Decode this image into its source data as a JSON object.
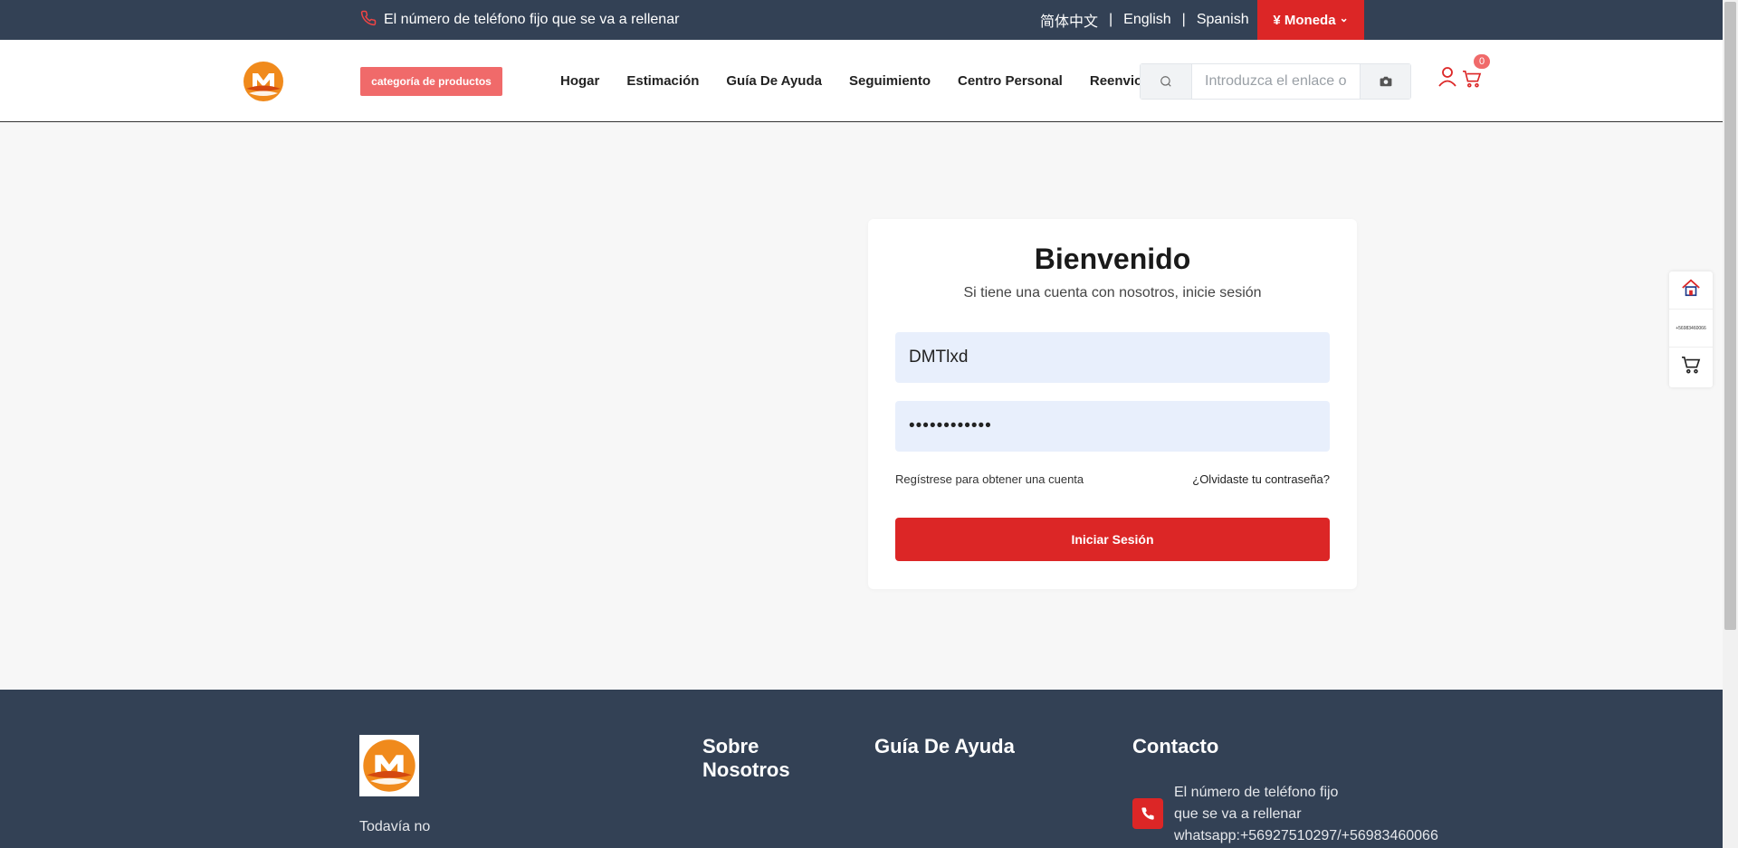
{
  "topbar": {
    "phone_text": "El número de teléfono fijo que se va a rellenar",
    "lang_zh": "简体中文",
    "lang_en": "English",
    "lang_es": "Spanish",
    "separator": "|",
    "currency_label": "¥ Moneda",
    "currency_chevron": "⌄"
  },
  "header": {
    "category_button": "categoría de productos",
    "nav": [
      "Hogar",
      "Estimación",
      "Guía De Ayuda",
      "Seguimiento",
      "Centro Personal",
      "Reenvio"
    ],
    "search_placeholder": "Introduzca el enlace o",
    "cart_count": "0"
  },
  "login": {
    "title": "Bienvenido",
    "subtitle": "Si tiene una cuenta con nosotros, inicie sesión",
    "username_value": "DMTlxd",
    "password_value": "••••••••••••",
    "register_link": "Regístrese para obtener una cuenta",
    "forgot_link": "¿Olvidaste tu contraseña?",
    "submit_label": "Iniciar Sesión"
  },
  "side_widget": {
    "phone_small": "+56983460066"
  },
  "footer": {
    "about_text": "Todavía no",
    "about_heading": "Sobre Nosotros",
    "help_heading": "Guía De Ayuda",
    "contact_heading": "Contacto",
    "contact_line1": "El número de teléfono fijo que se va a rellenar",
    "contact_line2": "whatsapp:+56927510297/+56983460066"
  },
  "colors": {
    "topbar_bg": "#334155",
    "accent_red": "#dc2626",
    "category_btn": "#f06a6a",
    "logo_orange": "#f08a1c"
  }
}
